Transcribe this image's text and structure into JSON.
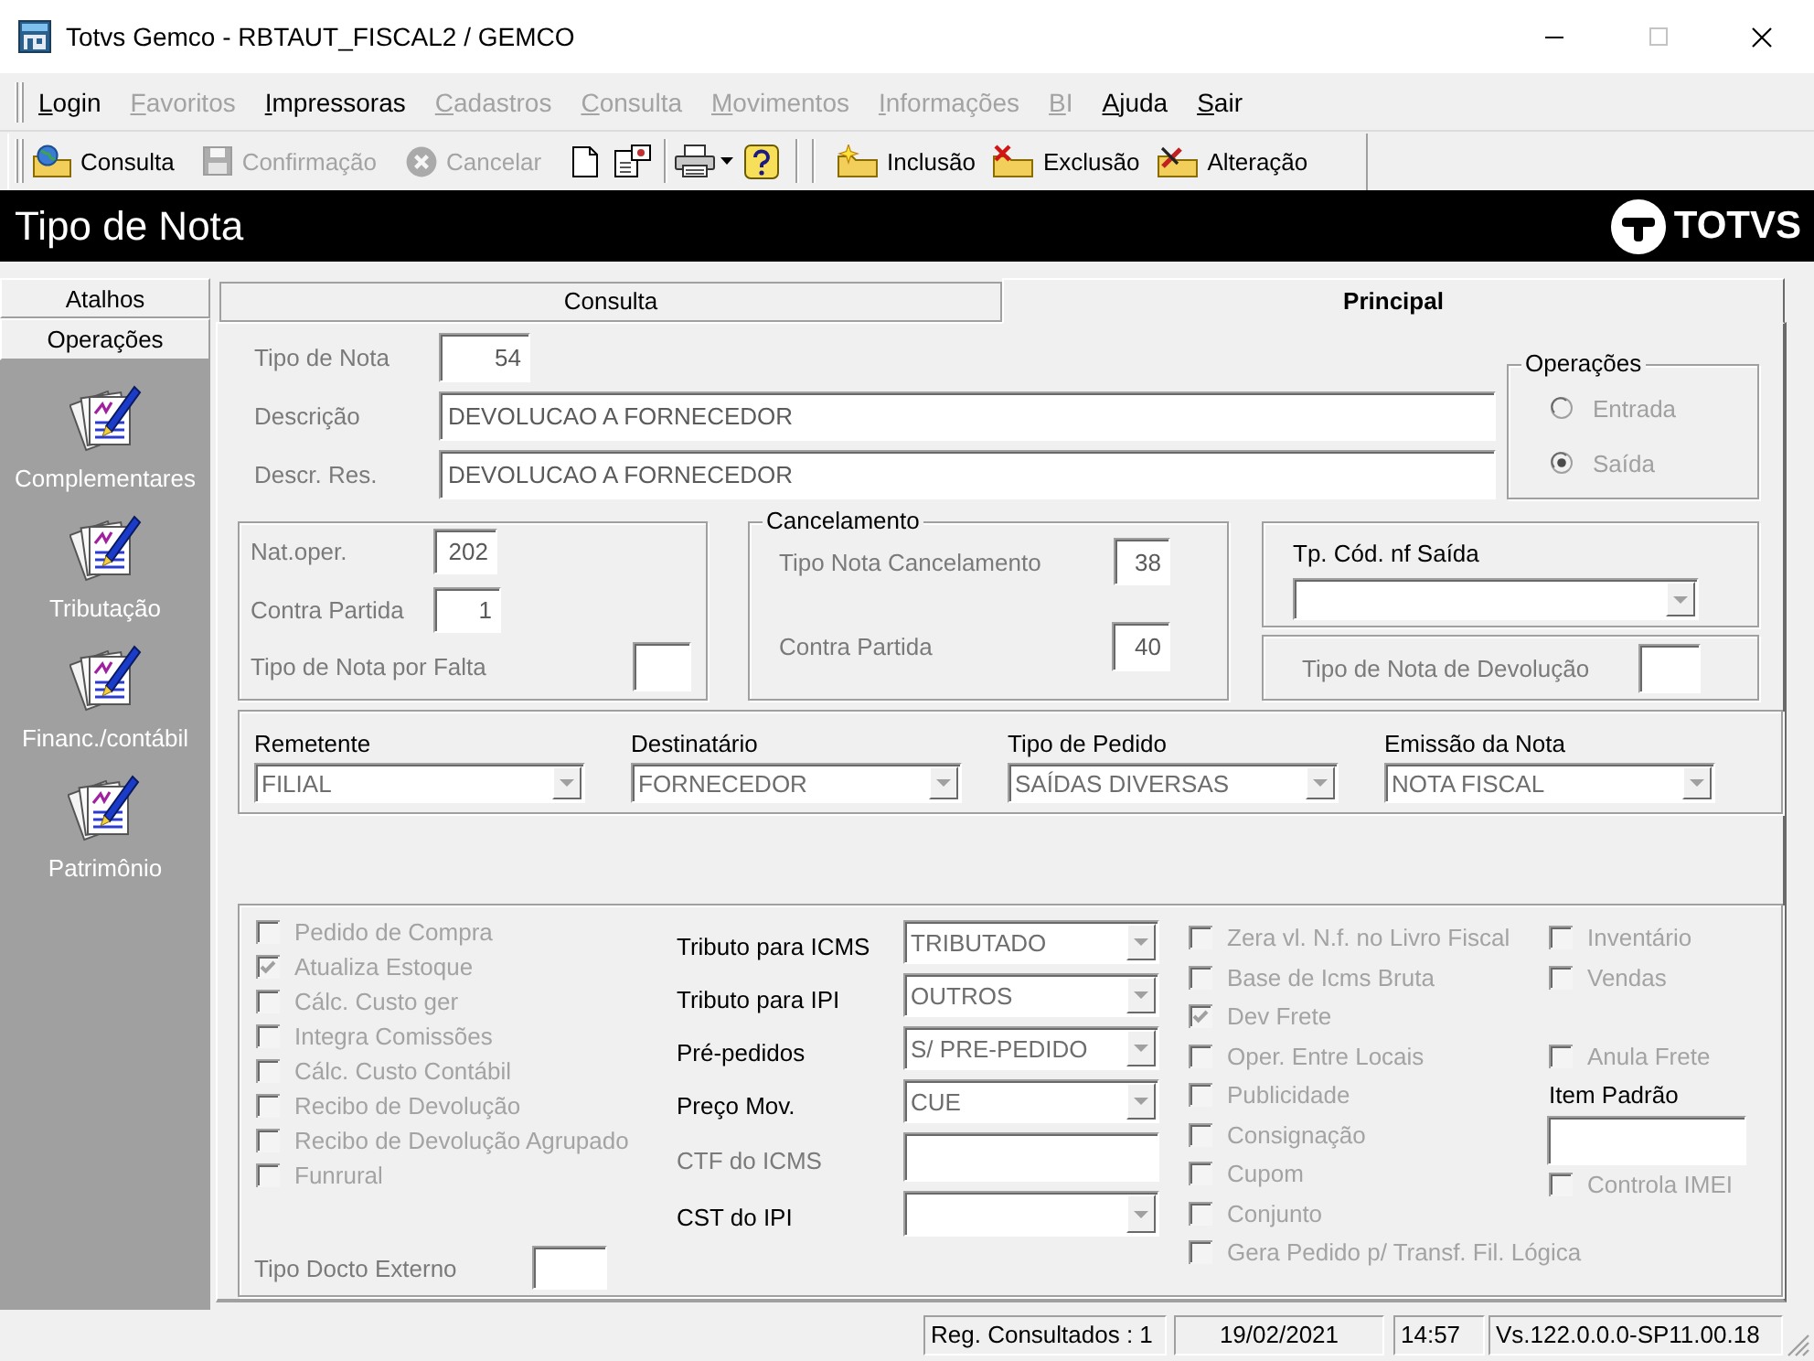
{
  "window": {
    "title": "Totvs Gemco - RBTAUT_FISCAL2 / GEMCO",
    "maximize_disabled": true
  },
  "menu": [
    {
      "label": "Login",
      "disabled": false
    },
    {
      "label": "Favoritos",
      "disabled": true
    },
    {
      "label": "Impressoras",
      "disabled": false
    },
    {
      "label": "Cadastros",
      "disabled": true
    },
    {
      "label": "Consulta",
      "disabled": true
    },
    {
      "label": "Movimentos",
      "disabled": true
    },
    {
      "label": "Informações",
      "disabled": true
    },
    {
      "label": "BI",
      "disabled": true
    },
    {
      "label": "Ajuda",
      "disabled": false
    },
    {
      "label": "Sair",
      "disabled": false
    }
  ],
  "toolbar": {
    "actions": [
      {
        "label": "Consulta",
        "disabled": false
      },
      {
        "label": "Confirmação",
        "disabled": true
      },
      {
        "label": "Cancelar",
        "disabled": true
      }
    ],
    "records": [
      {
        "label": "Inclusão"
      },
      {
        "label": "Exclusão"
      },
      {
        "label": "Alteração"
      }
    ]
  },
  "header": {
    "title": "Tipo de Nota",
    "logo": "TOTVS"
  },
  "sidebar": {
    "sections": [
      {
        "label": "Atalhos"
      },
      {
        "label": "Operações"
      }
    ],
    "items": [
      {
        "label": "Complementares"
      },
      {
        "label": "Tributação"
      },
      {
        "label": "Financ./contábil"
      },
      {
        "label": "Patrimônio"
      }
    ]
  },
  "tabs": [
    {
      "label": "Consulta",
      "selected": false
    },
    {
      "label": "Principal",
      "selected": true
    }
  ],
  "main_fields": [
    {
      "label": "Tipo de Nota",
      "value": "54"
    },
    {
      "label": "Descrição",
      "value": "DEVOLUCAO A FORNECEDOR"
    },
    {
      "label": "Descr. Res.",
      "value": "DEVOLUCAO A FORNECEDOR"
    }
  ],
  "operacoes": {
    "title": "Operações",
    "options": [
      {
        "label": "Entrada",
        "selected": false
      },
      {
        "label": "Saída",
        "selected": true
      }
    ]
  },
  "natureza": [
    {
      "label": "Nat.oper.",
      "value": "202"
    },
    {
      "label": "Contra Partida",
      "value": "1"
    },
    {
      "label": "Tipo de Nota por Falta"
    }
  ],
  "cancelamento": {
    "title": "Cancelamento",
    "fields": [
      {
        "label": "Tipo Nota Cancelamento",
        "value": "38"
      },
      {
        "label": "Contra Partida",
        "value": "40"
      }
    ]
  },
  "tp_cod_nf_saida": {
    "label": "Tp. Cód. nf Saída"
  },
  "tipo_nota_devolucao": {
    "label": "Tipo de Nota de Devolução"
  },
  "parties": [
    {
      "label": "Remetente",
      "value": "FILIAL"
    },
    {
      "label": "Destinatário",
      "value": "FORNECEDOR"
    },
    {
      "label": "Tipo de Pedido",
      "value": "SAÍDAS DIVERSAS"
    },
    {
      "label": "Emissão da Nota",
      "value": "NOTA FISCAL"
    }
  ],
  "flags_left": [
    {
      "label": "Pedido de Compra",
      "checked": false
    },
    {
      "label": "Atualiza Estoque",
      "checked": true
    },
    {
      "label": "Cálc. Custo ger",
      "checked": false
    },
    {
      "label": "Integra Comissões",
      "checked": false
    },
    {
      "label": "Cálc. Custo Contábil",
      "checked": false
    },
    {
      "label": "Recibo de Devolução",
      "checked": false
    },
    {
      "label": "Recibo de Devolução Agrupado",
      "checked": false
    },
    {
      "label": "Funrural",
      "checked": false
    }
  ],
  "taxes": [
    {
      "label": "Tributo para ICMS",
      "kind": "dropdown",
      "value": "TRIBUTADO",
      "disabled": false
    },
    {
      "label": "Tributo para IPI",
      "kind": "dropdown",
      "value": "OUTROS",
      "disabled": false
    },
    {
      "label": "Pré-pedidos",
      "kind": "dropdown",
      "value": "S/ PRE-PEDIDO",
      "disabled": false
    },
    {
      "label": "Preço Mov.",
      "kind": "dropdown",
      "value": "CUE",
      "disabled": false
    },
    {
      "label": "CTF do ICMS",
      "kind": "text",
      "disabled": true
    },
    {
      "label": "CST do IPI",
      "kind": "dropdown",
      "disabled": false
    }
  ],
  "tipo_docto_externo": {
    "label": "Tipo Docto Externo"
  },
  "flags_middle": [
    {
      "label": "Zera vl. N.f. no Livro Fiscal",
      "checked": false
    },
    {
      "label": "Base de Icms Bruta",
      "checked": false
    },
    {
      "label": "Dev Frete",
      "checked": true
    },
    {
      "label": "Oper. Entre Locais",
      "checked": false
    },
    {
      "label": "Publicidade",
      "checked": false
    },
    {
      "label": "Consignação",
      "checked": false
    },
    {
      "label": "Cupom",
      "checked": false
    },
    {
      "label": "Conjunto",
      "checked": false
    },
    {
      "label": "Gera Pedido p/ Transf. Fil. Lógica",
      "checked": false
    }
  ],
  "flags_right": [
    {
      "label": "Inventário",
      "checked": false
    },
    {
      "label": "Vendas",
      "checked": false
    },
    {
      "label": "Anula Frete",
      "checked": false
    }
  ],
  "item_padrao": {
    "label": "Item Padrão"
  },
  "controla_imei": {
    "label": "Controla IMEI",
    "checked": false
  },
  "status_bar": [
    "Reg. Consultados : 1",
    "19/02/2021",
    "14:57",
    "Vs.122.0.0.0-SP11.00.18"
  ]
}
